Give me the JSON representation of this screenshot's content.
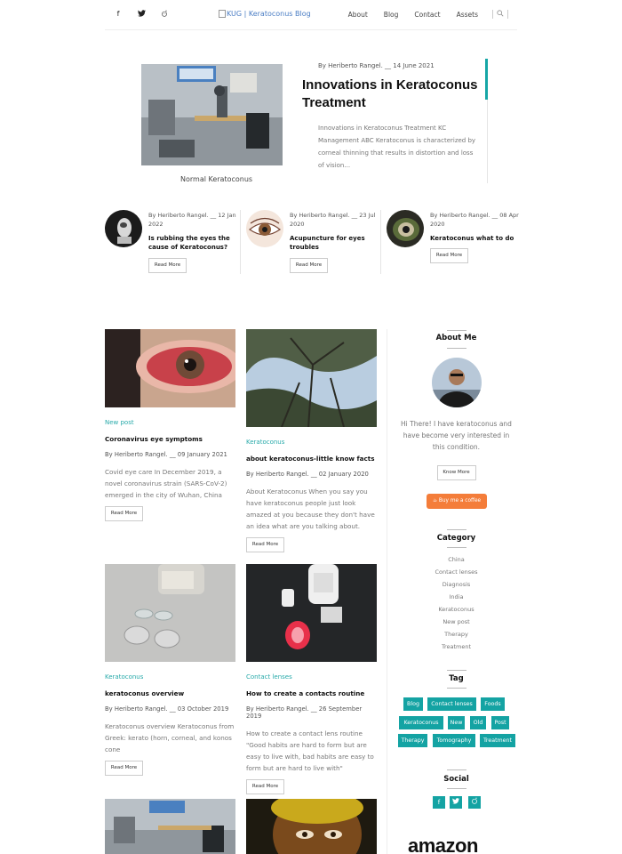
{
  "header": {
    "social": [
      "f",
      "t",
      "r"
    ],
    "logo_alt": "KUG | Keratoconus Blog",
    "nav": [
      "About",
      "Blog",
      "Contact",
      "Assets"
    ],
    "search_icon": "magnifier"
  },
  "hero": {
    "meta": "By Heriberto Rangel.  __ 14 June 2021",
    "title": "Innovations in Keratoconus Treatment",
    "excerpt": "Innovations in Keratoconus Treatment KC Management ABC Keratoconus is characterized by corneal thinning that results in distortion and loss of vision...",
    "caption": "Normal          Keratoconus"
  },
  "featured": [
    {
      "meta": "By Heriberto Rangel.  __ 12 Jan 2022",
      "title": "Is rubbing the eyes the cause of Keratoconus?",
      "button": "Read More"
    },
    {
      "meta": "By Heriberto Rangel.  __ 23 Jul 2020",
      "title": "Acupuncture for eyes troubles",
      "button": "Read More"
    },
    {
      "meta": "By Heriberto Rangel.  __ 08 Apr 2020",
      "title": "Keratoconus what to do",
      "button": "Read More"
    }
  ],
  "posts": [
    {
      "category": "New post",
      "title": "Coronavirus eye symptoms",
      "meta": "By Heriberto Rangel.  __ 09 January 2021",
      "excerpt": "Covid eye care In December 2019, a novel coronavirus strain (SARS-CoV-2) emerged in the city of Wuhan, China",
      "button": "Read More"
    },
    {
      "category": "Keratoconus",
      "title": "about keratoconus-little know facts",
      "meta": "By Heriberto Rangel.  __ 02 January 2020",
      "excerpt": "About Keratoconus When you say you have keratoconus people just look amazed at you because they don't have an idea what are you talking about.",
      "button": "Read More"
    },
    {
      "category": "Keratoconus",
      "title": "keratoconus overview",
      "meta": "By Heriberto Rangel.  __ 03 October 2019",
      "excerpt": "Keratoconus overview Keratoconus from Greek: kerato (horn, corneal, and konos cone",
      "button": "Read More"
    },
    {
      "category": "Contact lenses",
      "title": "How to create a contacts routine",
      "meta": "By Heriberto Rangel.  __ 26 September 2019",
      "excerpt": "How to create a contact lens routine \"Good habits are hard to form but are easy to live with, bad habits are easy to form but are hard to live with\"",
      "button": "Read More"
    }
  ],
  "sidebar": {
    "about_title": "About Me",
    "about_text": "Hi There! I have keratoconus and have become very interested in this condition.",
    "about_button": "Know More",
    "coffee": "Buy me a coffee",
    "category_title": "Category",
    "categories": [
      "China",
      "Contact lenses",
      "Diagnosis",
      "India",
      "Keratoconus",
      "New post",
      "Therapy",
      "Treatment"
    ],
    "tag_title": "Tag",
    "tags": [
      "Blog",
      "Contact lenses",
      "Foods",
      "Keratoconus",
      "New",
      "Old",
      "Post",
      "Therapy",
      "Tomography",
      "Treatment"
    ],
    "social_title": "Social",
    "social": [
      "f",
      "t",
      "r"
    ],
    "amazon": "amazon"
  },
  "colors": {
    "accent": "#14a3a3",
    "coffee": "#f47d3a",
    "link": "#4a7dc4"
  }
}
